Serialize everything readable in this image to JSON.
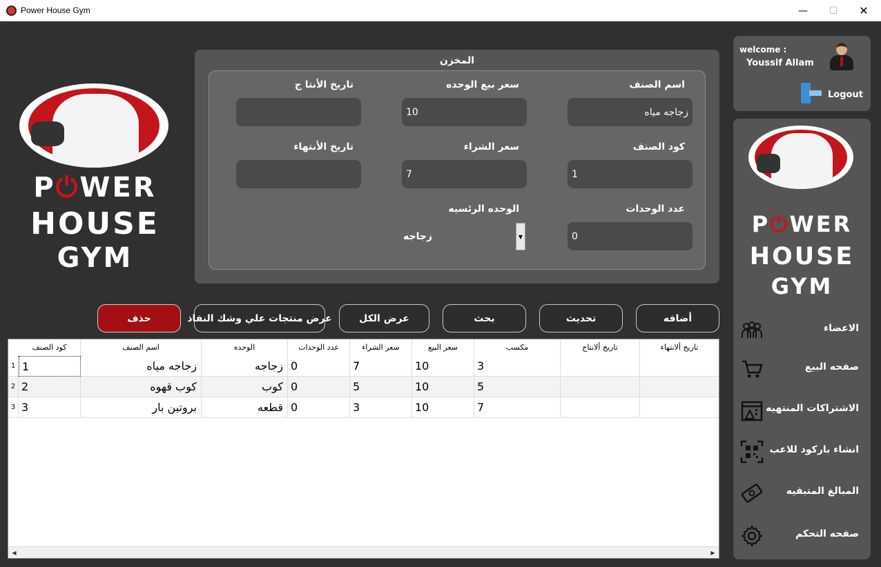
{
  "window": {
    "title": "Power House Gym",
    "minimize": "—",
    "maximize": "☐",
    "close": "✕"
  },
  "brand": {
    "line1_a": "P",
    "line1_o": "⏻",
    "line1_b": "WER",
    "line2": "HOUSE",
    "line3": "GYM"
  },
  "form": {
    "title": "المخزن",
    "item_name_label": "اسم الصنف",
    "item_name_value": "زجاجه مياه",
    "sell_price_label": "سعر بيع الوحده",
    "sell_price_value": "10",
    "production_date_label": "تاريخ الأنتا ج",
    "production_date_value": "",
    "item_code_label": "كود الصنف",
    "item_code_value": "1",
    "buy_price_label": "سعر الشراء",
    "buy_price_value": "7",
    "expiry_date_label": "تاريخ الأنتهاء",
    "expiry_date_value": "",
    "units_count_label": "عدد الوحدات",
    "units_count_value": "0",
    "main_unit_label": "الوحده الرئسيه",
    "main_unit_value": "زجاجه"
  },
  "buttons": {
    "add": "أضافه",
    "update": "تحديث",
    "search": "بحث",
    "show_all": "عرض الكل",
    "near_expiry": "عرض منتجات علي وشك النفاذ",
    "delete": "حذف"
  },
  "table": {
    "headers": [
      "كود الصنف",
      "اسم الصنف",
      "الوحده",
      "عدد الوحدات",
      "سعر الشراء",
      "سعر البيع",
      "مكسب",
      "تاريخ ألانتاج",
      "تاريخ ألانتهاء"
    ],
    "rows": [
      {
        "num": "1",
        "code": "1",
        "name": "زجاجه مياه",
        "unit": "زجاجه",
        "count": "0",
        "buy": "7",
        "sell": "10",
        "profit": "3",
        "prod": "",
        "exp": ""
      },
      {
        "num": "2",
        "code": "2",
        "name": "كوب قهوه",
        "unit": "كوب",
        "count": "0",
        "buy": "5",
        "sell": "10",
        "profit": "5",
        "prod": "",
        "exp": ""
      },
      {
        "num": "3",
        "code": "3",
        "name": "بروتين بار",
        "unit": "قطعه",
        "count": "0",
        "buy": "3",
        "sell": "10",
        "profit": "7",
        "prod": "",
        "exp": ""
      }
    ]
  },
  "user": {
    "welcome": "welcome :",
    "name": "Youssif Allam",
    "logout": "Logout"
  },
  "nav": {
    "members": "الاعضاء",
    "sales": "صفحه البيع",
    "expired": "الاشتراكات المنتهيه",
    "barcode": "انشاء باركود للاعب",
    "remaining": "المبالغ المتبقيه",
    "dashboard": "صفحه التحكم"
  },
  "colors": {
    "background": "#303030",
    "panel": "#555555",
    "accent_red": "#c4151c"
  }
}
